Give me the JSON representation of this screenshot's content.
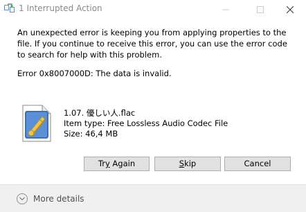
{
  "window": {
    "title": "1 Interrupted Action"
  },
  "titlebar_buttons": {
    "minimize_icon": "minimize-icon",
    "maximize_icon": "maximize-icon",
    "close_icon": "close-icon"
  },
  "message": {
    "text": "An unexpected error is keeping you from applying properties to the file. If you continue to receive this error, you can use the error code to search for help with this problem.",
    "error": "Error 0x8007000D: The data is invalid."
  },
  "file": {
    "name": "1.07. 優しい人.flac",
    "type": "Item type: Free Lossless Audio Codec File",
    "size": "Size: 46,4 MB",
    "icon": "audio-file-icon"
  },
  "buttons": {
    "try_again_prefix": "Tr",
    "try_again_accel": "y",
    "try_again_suffix": " Again",
    "skip_accel": "S",
    "skip_suffix": "kip",
    "cancel": "Cancel"
  },
  "footer": {
    "more_details": "More details"
  },
  "colors": {
    "title_text": "#8a8a8a",
    "button_bg": "#e1e1e1",
    "footer_bg": "#f0f0f0"
  }
}
